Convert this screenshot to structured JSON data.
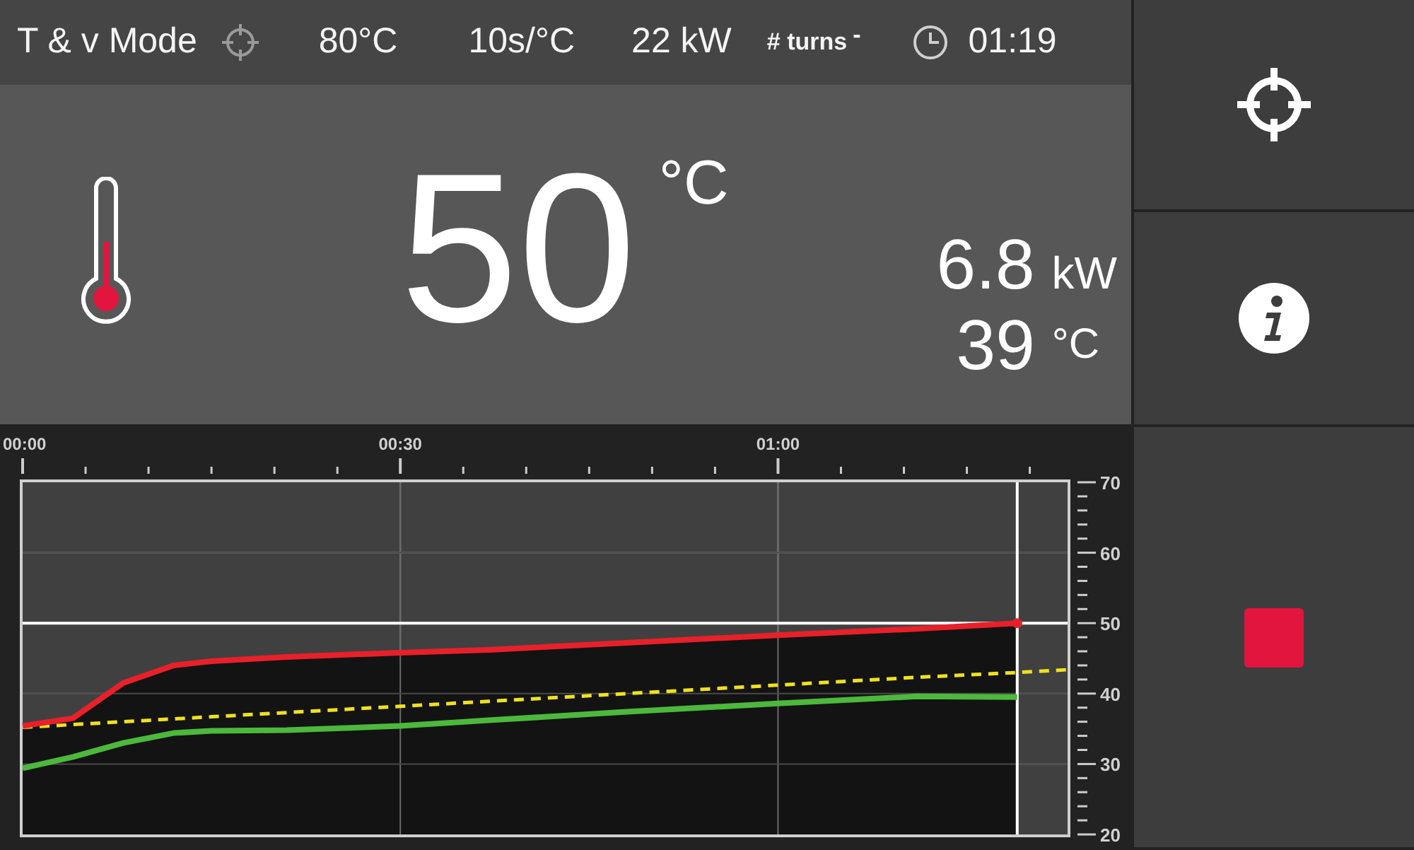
{
  "header": {
    "mode": "T & v Mode",
    "target": "80°C",
    "rate": "10s/°C",
    "power": "22 kW",
    "turns_label": "# turns",
    "turns_value": "-",
    "time": "01:19"
  },
  "main": {
    "temperature": "50",
    "temperature_unit": "°C",
    "power": "6.8",
    "power_unit": "kW",
    "secondary_temperature": "39",
    "secondary_unit": "°C"
  },
  "chart": {
    "chart_data": {
      "type": "line",
      "x": [
        0,
        4,
        8,
        12,
        15,
        21,
        30,
        37,
        48,
        60,
        71,
        79,
        83
      ],
      "series": [
        {
          "color": "#e8202a",
          "line_style": "solid",
          "values": [
            35.4,
            36.5,
            41.5,
            44,
            44.6,
            45.2,
            45.8,
            46.2,
            47.2,
            48.3,
            49.2,
            50,
            null
          ]
        },
        {
          "color": "#f0e020",
          "line_style": "dashed",
          "values": [
            35.2,
            35.6,
            36.0,
            36.4,
            36.7,
            37.3,
            38.2,
            38.9,
            40.0,
            41.2,
            42.3,
            43.0,
            43.4
          ]
        },
        {
          "color": "#4cb83c",
          "line_style": "solid",
          "values": [
            29.4,
            31,
            33,
            34.4,
            34.7,
            34.8,
            35.4,
            36.2,
            37.4,
            38.6,
            39.6,
            39.5,
            null
          ]
        }
      ],
      "xlim": [
        0,
        83
      ],
      "ylim": [
        20,
        70
      ],
      "xticks": [
        {
          "value": 0,
          "label": "00:00"
        },
        {
          "value": 30,
          "label": "00:30"
        },
        {
          "value": 60,
          "label": "01:00"
        }
      ],
      "yticks": [
        20,
        30,
        40,
        50,
        60,
        70
      ],
      "grid": true,
      "ref_lines": [
        {
          "axis": "y",
          "value": 50
        },
        {
          "axis": "x",
          "value": 79
        }
      ]
    }
  },
  "sidebar": {
    "buttons": [
      {
        "kind": "target"
      },
      {
        "kind": "info"
      },
      {
        "kind": "stop"
      }
    ]
  }
}
